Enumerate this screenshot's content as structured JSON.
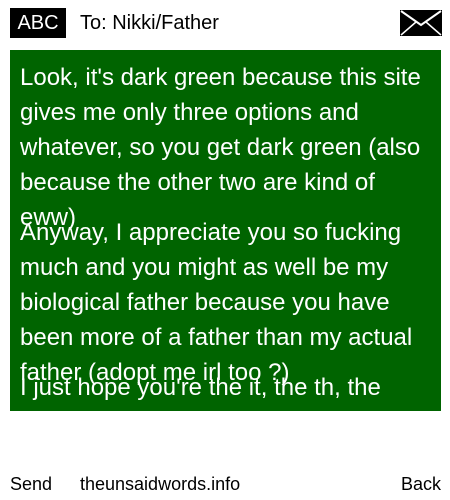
{
  "header": {
    "input_mode": "ABC",
    "recipient": "To: Nikki/Father",
    "icon": "envelope-icon"
  },
  "message": {
    "background_color": "#006400",
    "text_color": "#ffffff",
    "paragraphs": [
      "Look, it's dark green because this site gives me only three options and whatever, so you get dark green (also because the other two are kind of eww)",
      "Anyway, I appreciate you so fucking much and you might as well be my biological father because you have been more of a father than my actual father (adopt me irl too ?)",
      "I just hope you're the it, the th, the"
    ]
  },
  "footer": {
    "send_label": "Send",
    "site_label": "theunsaidwords.info",
    "back_label": "Back"
  }
}
